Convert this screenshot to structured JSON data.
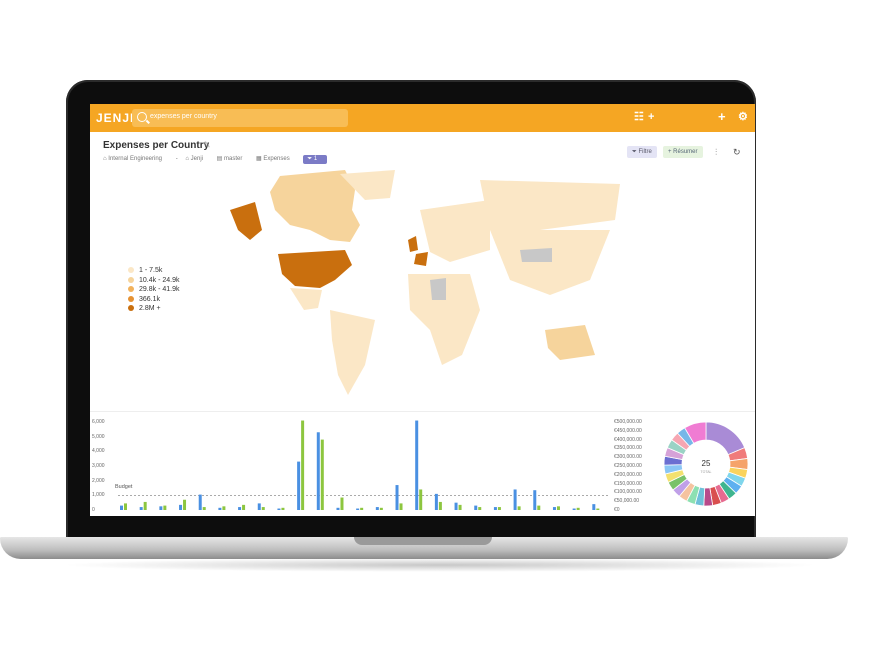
{
  "app": {
    "logo": "JENJI",
    "search_query": "expenses per country",
    "grid_icon": "grid-icon",
    "add_icon": "plus-icon",
    "settings_icon": "gear-icon"
  },
  "report": {
    "title": "Expenses per Country",
    "breadcrumb": [
      "Internal Engineering",
      "-",
      "Jenji",
      "master",
      "Expenses"
    ],
    "filter_count": "1",
    "filter_button": "Filtre",
    "summary_button": "Résumer"
  },
  "map_legend": [
    {
      "label": "1 - 7.5k",
      "color": "#fbe7c6"
    },
    {
      "label": "10.4k - 24.9k",
      "color": "#f6d49c"
    },
    {
      "label": "29.8k - 41.9k",
      "color": "#f2b25c"
    },
    {
      "label": "366.1k",
      "color": "#e69233"
    },
    {
      "label": "2.8M +",
      "color": "#c96f0e"
    }
  ],
  "chart_data": [
    {
      "type": "bar",
      "ylabel_ticks": [
        "6,000",
        "5,000",
        "4,000",
        "3,000",
        "2,000",
        "1,000",
        "0"
      ],
      "ylim": [
        0,
        6000
      ],
      "reference_line": {
        "label": "Budget",
        "value": 1000
      },
      "series": [
        {
          "color": "#4a90e2",
          "values": [
            300,
            200,
            250,
            350,
            1050,
            150,
            200,
            450,
            100,
            3300,
            5300,
            150,
            100,
            200,
            1700,
            6100,
            1100,
            500,
            300,
            200,
            1400,
            1350,
            200,
            100,
            400
          ]
        },
        {
          "color": "#8dc63f",
          "values": [
            450,
            550,
            300,
            700,
            200,
            250,
            350,
            200,
            150,
            6100,
            4800,
            850,
            150,
            150,
            450,
            1400,
            550,
            350,
            200,
            200,
            250,
            300,
            250,
            150,
            100
          ]
        }
      ],
      "right_axis_ticks": [
        "€500,000.00",
        "€450,000.00",
        "€400,000.00",
        "€350,000.00",
        "€300,000.00",
        "€250,000.00",
        "€200,000.00",
        "€150,000.00",
        "€100,000.00",
        "€50,000.00",
        "€0"
      ]
    },
    {
      "type": "pie",
      "center_value": "25",
      "center_label": "TOTAL",
      "values": [
        22,
        5,
        5,
        4,
        4,
        4,
        4,
        4,
        4,
        4,
        4,
        4,
        4,
        4,
        4,
        4,
        4,
        4,
        4,
        4,
        4,
        4,
        10
      ],
      "colors": [
        "#a98bd6",
        "#f07b7b",
        "#f5a36a",
        "#f9d35d",
        "#7fd6ec",
        "#5eb0f0",
        "#3fb58f",
        "#e66b90",
        "#d94f4f",
        "#b84a8a",
        "#6fc0d9",
        "#8de0b2",
        "#f5c3a0",
        "#c0a0e8",
        "#79c26a",
        "#f3e16f",
        "#8ac6f5",
        "#6b6fd1",
        "#d6a2d8",
        "#9ad3c5",
        "#f6a6b2",
        "#77b7e8",
        "#f07cd3"
      ]
    }
  ]
}
